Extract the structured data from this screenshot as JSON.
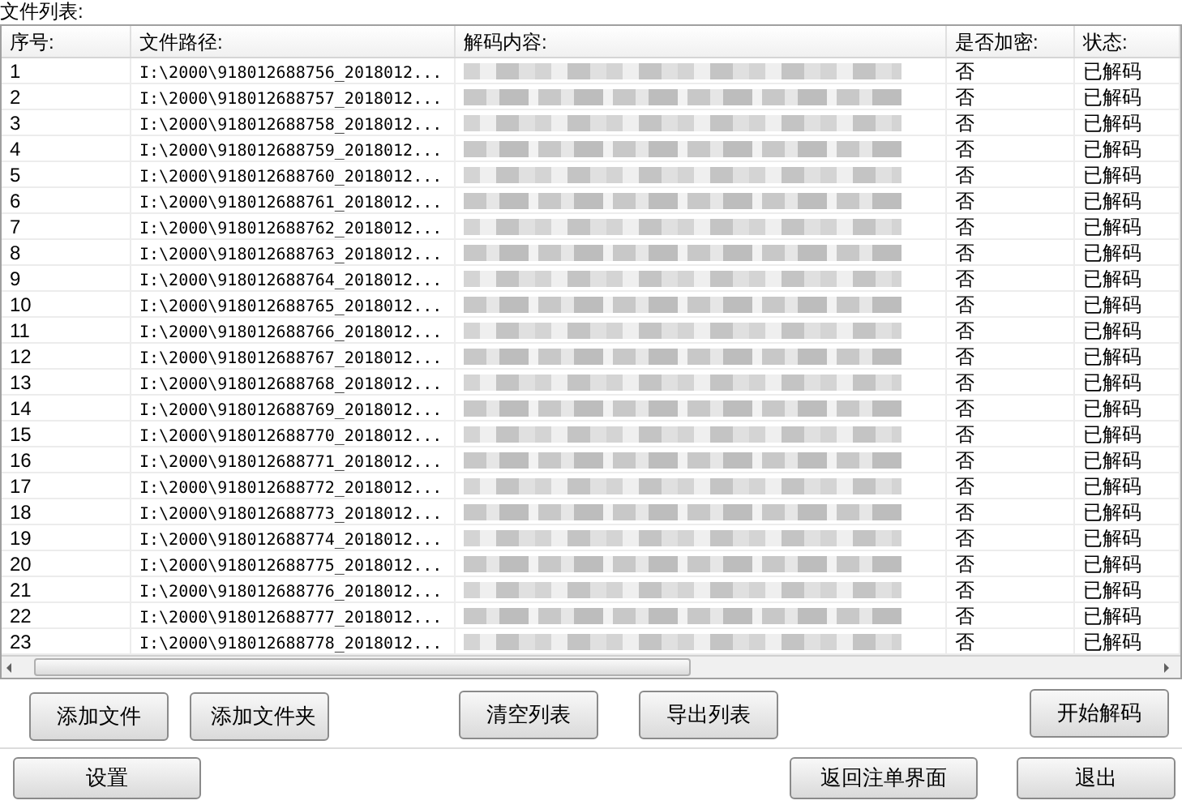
{
  "list_label": "文件列表:",
  "table": {
    "columns": [
      "序号:",
      "文件路径:",
      "解码内容:",
      "是否加密:",
      "状态:"
    ],
    "rows": [
      {
        "index": "1",
        "path": "I:\\2000\\918012688756_2018012...",
        "encrypted": "否",
        "status": "已解码"
      },
      {
        "index": "2",
        "path": "I:\\2000\\918012688757_2018012...",
        "encrypted": "否",
        "status": "已解码"
      },
      {
        "index": "3",
        "path": "I:\\2000\\918012688758_2018012...",
        "encrypted": "否",
        "status": "已解码"
      },
      {
        "index": "4",
        "path": "I:\\2000\\918012688759_2018012...",
        "encrypted": "否",
        "status": "已解码"
      },
      {
        "index": "5",
        "path": "I:\\2000\\918012688760_2018012...",
        "encrypted": "否",
        "status": "已解码"
      },
      {
        "index": "6",
        "path": "I:\\2000\\918012688761_2018012...",
        "encrypted": "否",
        "status": "已解码"
      },
      {
        "index": "7",
        "path": "I:\\2000\\918012688762_2018012...",
        "encrypted": "否",
        "status": "已解码"
      },
      {
        "index": "8",
        "path": "I:\\2000\\918012688763_2018012...",
        "encrypted": "否",
        "status": "已解码"
      },
      {
        "index": "9",
        "path": "I:\\2000\\918012688764_2018012...",
        "encrypted": "否",
        "status": "已解码"
      },
      {
        "index": "10",
        "path": "I:\\2000\\918012688765_2018012...",
        "encrypted": "否",
        "status": "已解码"
      },
      {
        "index": "11",
        "path": "I:\\2000\\918012688766_2018012...",
        "encrypted": "否",
        "status": "已解码"
      },
      {
        "index": "12",
        "path": "I:\\2000\\918012688767_2018012...",
        "encrypted": "否",
        "status": "已解码"
      },
      {
        "index": "13",
        "path": "I:\\2000\\918012688768_2018012...",
        "encrypted": "否",
        "status": "已解码"
      },
      {
        "index": "14",
        "path": "I:\\2000\\918012688769_2018012...",
        "encrypted": "否",
        "status": "已解码"
      },
      {
        "index": "15",
        "path": "I:\\2000\\918012688770_2018012...",
        "encrypted": "否",
        "status": "已解码"
      },
      {
        "index": "16",
        "path": "I:\\2000\\918012688771_2018012...",
        "encrypted": "否",
        "status": "已解码"
      },
      {
        "index": "17",
        "path": "I:\\2000\\918012688772_2018012...",
        "encrypted": "否",
        "status": "已解码"
      },
      {
        "index": "18",
        "path": "I:\\2000\\918012688773_2018012...",
        "encrypted": "否",
        "status": "已解码"
      },
      {
        "index": "19",
        "path": "I:\\2000\\918012688774_2018012...",
        "encrypted": "否",
        "status": "已解码"
      },
      {
        "index": "20",
        "path": "I:\\2000\\918012688775_2018012...",
        "encrypted": "否",
        "status": "已解码"
      },
      {
        "index": "21",
        "path": "I:\\2000\\918012688776_2018012...",
        "encrypted": "否",
        "status": "已解码"
      },
      {
        "index": "22",
        "path": "I:\\2000\\918012688777_2018012...",
        "encrypted": "否",
        "status": "已解码"
      },
      {
        "index": "23",
        "path": "I:\\2000\\918012688778_2018012...",
        "encrypted": "否",
        "status": "已解码"
      }
    ]
  },
  "actions": [
    "添加文件",
    "添加文件夹",
    "清空列表",
    "导出列表",
    "开始解码"
  ],
  "bottom_buttons": [
    "设置",
    "返回注单界面",
    "退出"
  ]
}
